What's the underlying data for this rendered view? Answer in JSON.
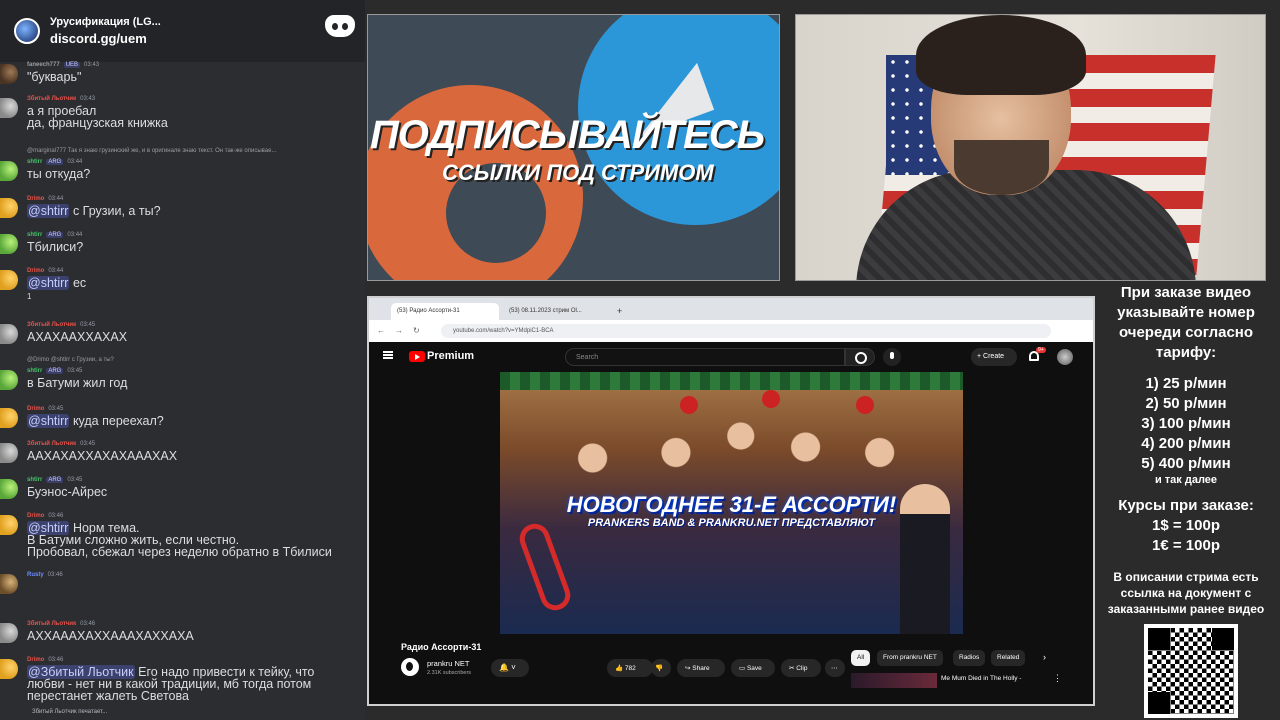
{
  "discord": {
    "server_name": "Урусификация (LG...",
    "invite": "discord.gg/uem",
    "messages": [
      {
        "author": "faneech777",
        "tag": "UEB",
        "time": "03:43",
        "text": "\"букварь\"",
        "avatar": "dark",
        "color": "t-gray"
      },
      {
        "author": "Збитый Льотчик",
        "tag": "",
        "time": "03:43",
        "text": "а я проебал",
        "text2": "да, французская книжка",
        "avatar": "girl",
        "color": "t-red"
      },
      {
        "reply": "@marginal777 Так я знаю грузинский же, и в оригинале знаю текст. Он так-же описывае...",
        "author": "shtirr",
        "tag": "ARG",
        "time": "03:44",
        "text": "ты откуда?",
        "avatar": "alien",
        "color": "t-green"
      },
      {
        "author": "Drimo",
        "tag": "",
        "time": "03:44",
        "mention": "@shtirr",
        "text": " с Грузии, а ты?",
        "avatar": "cookie",
        "color": "t-red"
      },
      {
        "author": "shtirr",
        "tag": "ARG",
        "time": "03:44",
        "text": "Тбилиси?",
        "avatar": "alien",
        "color": "t-green"
      },
      {
        "author": "Drimo",
        "tag": "",
        "time": "03:44",
        "mention": "@shtirr",
        "text": " ес",
        "reaction": "1",
        "avatar": "cookie",
        "color": "t-red"
      },
      {
        "author": "Збитый Льотчик",
        "tag": "",
        "time": "03:45",
        "text": "АХАХААХХАХАХ",
        "avatar": "girl",
        "color": "t-red"
      },
      {
        "reply": "@Drimo @shtirr с Грузии, а ты?",
        "author": "shtirr",
        "tag": "ARG",
        "time": "03:45",
        "text": "в Батуми жил год",
        "avatar": "alien",
        "color": "t-green"
      },
      {
        "author": "Drimo",
        "tag": "",
        "time": "03:45",
        "mention": "@shtirr",
        "text": " куда переехал?",
        "avatar": "cookie",
        "color": "t-red"
      },
      {
        "author": "Збитый Льотчик",
        "tag": "",
        "time": "03:45",
        "text": "ААХАХАХХАХАХАААХАХ",
        "avatar": "girl",
        "color": "t-red"
      },
      {
        "author": "shtirr",
        "tag": "ARG",
        "time": "03:45",
        "text": "Буэнос-Айрес",
        "avatar": "alien",
        "color": "t-green"
      },
      {
        "author": "Drimo",
        "tag": "",
        "time": "03:46",
        "mention": "@shtirr",
        "text": " Норм тема.",
        "text2": "В Батуми сложно жить, если честно.",
        "text3": "Пробовал, сбежал через неделю обратно в Тбилиси",
        "avatar": "cookie",
        "color": "t-red"
      },
      {
        "author": "Rusty",
        "tag": "",
        "time": "03:46",
        "text": "",
        "avatar": "cat",
        "color": "t-blue"
      },
      {
        "author": "Збитый Льотчик",
        "tag": "",
        "time": "03:46",
        "text": "АХХАААХАХХАААХАХХАХА",
        "avatar": "girl",
        "color": "t-red"
      },
      {
        "author": "Drimo",
        "tag": "",
        "time": "03:46",
        "mention": "@Збитый Льотчик",
        "text": " Его надо привести к тейку, что",
        "text2": "любви - нет ни в какой традиции, мб тогда потом",
        "text3": "перестанет жалеть Светова",
        "avatar": "cookie",
        "color": "t-red"
      }
    ],
    "typing": "Збитый Льотчик печатает..."
  },
  "promo": {
    "title": "ПОДПИСЫВАЙТЕСЬ",
    "subtitle": "ССЫЛКИ ПОД СТРИМОМ"
  },
  "browser": {
    "tab1": "(53) Радио Ассорти-31",
    "tab2": "(53) 08.11.2023 стрим Ol...",
    "url": "youtube.com/watch?v=YMdpiC1-BCA",
    "yt_brand": "Premium",
    "search_placeholder": "Search",
    "create_label": "Create",
    "notif_count": "9+",
    "video": {
      "title": "НОВОГОДНЕЕ 31-Е АССОРТИ!",
      "subtitle": "PRANKERS BAND & PRANKRU.NET ПРЕДСТАВЛЯЮТ"
    },
    "video_title": "Радио Ассорти-31",
    "channel": "prankru NET",
    "subscribers": "2.31K subscribers",
    "likes": "782",
    "share": "Share",
    "save": "Save",
    "clip": "Clip",
    "chips": [
      "All",
      "From prankru NET",
      "Radios",
      "Related"
    ],
    "rec_title": "Me Mum Died in The Holly -"
  },
  "info": {
    "hint": "При заказе видео указывайте номер очереди согласно тарифу:",
    "tariffs": [
      "1) 25 р/мин",
      "2) 50 р/мин",
      "3) 100 р/мин",
      "4) 200 р/мин",
      "5) 400 р/мин"
    ],
    "tariff_more": "и так далее",
    "courses_title": "Курсы при заказе:",
    "usd": "1$ = 100р",
    "eur": "1€ = 100р",
    "desc": "В описании стрима есть ссылка на документ с заказанными ранее видео"
  }
}
